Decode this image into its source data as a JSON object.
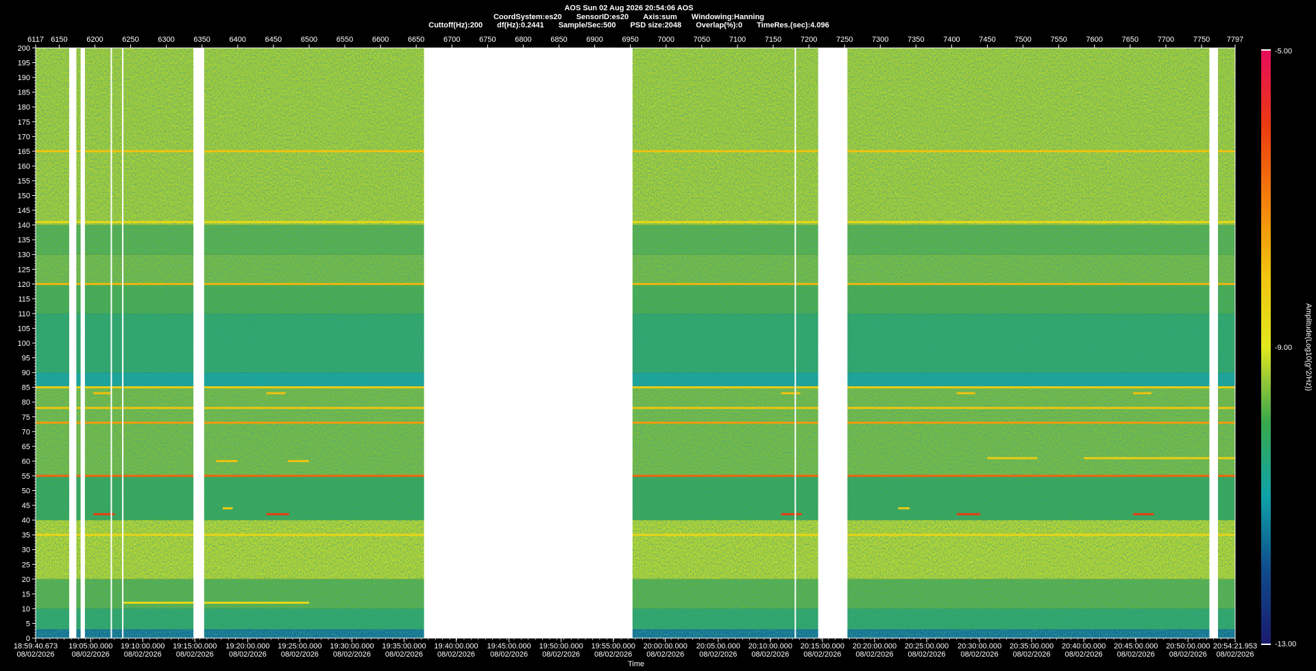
{
  "header": {
    "line1": "AOS  Sun 02 Aug 2026 20:54:06  AOS",
    "line2": [
      "CoordSystem:es20",
      "SensorID:es20",
      "Axis:sum",
      "Windowing:Hanning"
    ],
    "line3": [
      "Cuttoff(Hz):200",
      "df(Hz):0.2441",
      "Sample/Sec:500",
      "PSD size:2048",
      "Overlap(%):0",
      "TimeRes.(sec):4.096"
    ]
  },
  "chart_data": {
    "type": "heatmap",
    "title": "AOS  Sun 02 Aug 2026 20:54:06  AOS",
    "xlabel": "Time",
    "ylabel": "",
    "ylim": [
      0,
      200
    ],
    "y_ticks": [
      0,
      5,
      10,
      15,
      20,
      25,
      30,
      35,
      40,
      45,
      50,
      55,
      60,
      65,
      70,
      75,
      80,
      85,
      90,
      95,
      100,
      105,
      110,
      115,
      120,
      125,
      130,
      135,
      140,
      145,
      150,
      155,
      160,
      165,
      170,
      175,
      180,
      185,
      190,
      195,
      200
    ],
    "x_top_range": [
      6117,
      7797
    ],
    "x_top_ticks": [
      6117,
      6150,
      6200,
      6250,
      6300,
      6350,
      6400,
      6450,
      6500,
      6550,
      6600,
      6650,
      6700,
      6750,
      6800,
      6850,
      6900,
      6950,
      7000,
      7050,
      7100,
      7150,
      7200,
      7250,
      7300,
      7350,
      7400,
      7450,
      7500,
      7550,
      7600,
      7650,
      7700,
      7750,
      7797
    ],
    "x_bottom_ticks": [
      {
        "value": 6117,
        "time": "18:59:40.673",
        "date": "08/02/2026"
      },
      {
        "value": 6194,
        "time": "19:05:00.000",
        "date": "08/02/2026"
      },
      {
        "value": 6267,
        "time": "19:10:00.000",
        "date": "08/02/2026"
      },
      {
        "value": 6340,
        "time": "19:15:00.000",
        "date": "08/02/2026"
      },
      {
        "value": 6414,
        "time": "19:20:00.000",
        "date": "08/02/2026"
      },
      {
        "value": 6487,
        "time": "19:25:00.000",
        "date": "08/02/2026"
      },
      {
        "value": 6560,
        "time": "19:30:00.000",
        "date": "08/02/2026"
      },
      {
        "value": 6633,
        "time": "19:35:00.000",
        "date": "08/02/2026"
      },
      {
        "value": 6706,
        "time": "19:40:00.000",
        "date": "08/02/2026"
      },
      {
        "value": 6780,
        "time": "19:45:00.000",
        "date": "08/02/2026"
      },
      {
        "value": 6853,
        "time": "19:50:00.000",
        "date": "08/02/2026"
      },
      {
        "value": 6926,
        "time": "19:55:00.000",
        "date": "08/02/2026"
      },
      {
        "value": 6999,
        "time": "20:00:00.000",
        "date": "08/02/2026"
      },
      {
        "value": 7073,
        "time": "20:05:00.000",
        "date": "08/02/2026"
      },
      {
        "value": 7146,
        "time": "20:10:00.000",
        "date": "08/02/2026"
      },
      {
        "value": 7219,
        "time": "20:15:00.000",
        "date": "08/02/2026"
      },
      {
        "value": 7292,
        "time": "20:20:00.000",
        "date": "08/02/2026"
      },
      {
        "value": 7365,
        "time": "20:25:00.000",
        "date": "08/02/2026"
      },
      {
        "value": 7439,
        "time": "20:30:00.000",
        "date": "08/02/2026"
      },
      {
        "value": 7512,
        "time": "20:35:00.000",
        "date": "08/02/2026"
      },
      {
        "value": 7585,
        "time": "20:40:00.000",
        "date": "08/02/2026"
      },
      {
        "value": 7658,
        "time": "20:45:00.000",
        "date": "08/02/2026"
      },
      {
        "value": 7731,
        "time": "20:50:00.000",
        "date": "08/02/2026"
      },
      {
        "value": 7797,
        "time": "20:54:21.953",
        "date": "08/02/2026"
      }
    ],
    "data_gaps": [
      [
        6164,
        6174
      ],
      [
        6180,
        6186
      ],
      [
        6338,
        6353
      ],
      [
        6661,
        6953
      ],
      [
        7213,
        7254
      ],
      [
        7761,
        7773
      ]
    ],
    "gap_lines": [
      6223,
      6239,
      7181
    ],
    "background_bands": [
      {
        "y": [
          0,
          3
        ],
        "level": -11.6
      },
      {
        "y": [
          3,
          10
        ],
        "level": -10.3
      },
      {
        "y": [
          10,
          20
        ],
        "level": -9.8
      },
      {
        "y": [
          20,
          40
        ],
        "level": -9.2
      },
      {
        "y": [
          40,
          55
        ],
        "level": -10.1
      },
      {
        "y": [
          55,
          85
        ],
        "level": -9.6
      },
      {
        "y": [
          85,
          90
        ],
        "level": -10.9
      },
      {
        "y": [
          90,
          110
        ],
        "level": -10.3
      },
      {
        "y": [
          110,
          120
        ],
        "level": -9.9
      },
      {
        "y": [
          120,
          130
        ],
        "level": -9.6
      },
      {
        "y": [
          130,
          140
        ],
        "level": -9.8
      },
      {
        "y": [
          140,
          200
        ],
        "level": -9.3
      }
    ],
    "tone_lines": [
      {
        "y": 12,
        "level": -8.6,
        "x": [
          6240,
          6500
        ]
      },
      {
        "y": 35,
        "level": -8.5
      },
      {
        "y": 42,
        "level": -6.0,
        "x": [
          6198,
          6228
        ]
      },
      {
        "y": 42,
        "level": -6.0,
        "x": [
          6440,
          6472
        ]
      },
      {
        "y": 42,
        "level": -6.0,
        "x": [
          7161,
          7190
        ]
      },
      {
        "y": 42,
        "level": -6.0,
        "x": [
          7407,
          7440
        ]
      },
      {
        "y": 42,
        "level": -6.0,
        "x": [
          7654,
          7683
        ]
      },
      {
        "y": 44,
        "level": -8.2,
        "x": [
          6379,
          6393
        ]
      },
      {
        "y": 44,
        "level": -8.2,
        "x": [
          7325,
          7341
        ]
      },
      {
        "y": 55,
        "level": -6.6
      },
      {
        "y": 60,
        "level": -8.0,
        "x": [
          6370,
          6400
        ]
      },
      {
        "y": 60,
        "level": -8.0,
        "x": [
          6470,
          6500
        ]
      },
      {
        "y": 61,
        "level": -8.3,
        "x": [
          7450,
          7520
        ]
      },
      {
        "y": 61,
        "level": -8.3,
        "x": [
          7585,
          7797
        ]
      },
      {
        "y": 73,
        "level": -7.4
      },
      {
        "y": 78,
        "level": -8.1
      },
      {
        "y": 83,
        "level": -8.0,
        "x": [
          6198,
          6223
        ]
      },
      {
        "y": 83,
        "level": -8.0,
        "x": [
          6440,
          6467
        ]
      },
      {
        "y": 83,
        "level": -8.0,
        "x": [
          7161,
          7188
        ]
      },
      {
        "y": 83,
        "level": -8.0,
        "x": [
          7407,
          7433
        ]
      },
      {
        "y": 83,
        "level": -8.0,
        "x": [
          7654,
          7680
        ]
      },
      {
        "y": 85,
        "level": -8.2
      },
      {
        "y": 120,
        "level": -7.8
      },
      {
        "y": 141,
        "level": -8.6
      },
      {
        "y": 165,
        "level": -8.0
      }
    ],
    "colorbar": {
      "label": "Amplitude(Log10(g^2/Hz))",
      "range": [
        -13,
        -5
      ],
      "tick_labels": [
        {
          "value": -5,
          "text": "-5.00"
        },
        {
          "value": -9,
          "text": "-9.00"
        },
        {
          "value": -13,
          "text": "-13.00"
        }
      ],
      "stops": [
        {
          "value": -13,
          "color": "#1a1a6e"
        },
        {
          "value": -12,
          "color": "#0f4c8c"
        },
        {
          "value": -11,
          "color": "#0fa3a8"
        },
        {
          "value": -10,
          "color": "#3aa84a"
        },
        {
          "value": -9.5,
          "color": "#8ec43a"
        },
        {
          "value": -9,
          "color": "#e2e81e"
        },
        {
          "value": -8,
          "color": "#f1c20f"
        },
        {
          "value": -7,
          "color": "#f37f0c"
        },
        {
          "value": -6,
          "color": "#ec3a12"
        },
        {
          "value": -5,
          "color": "#e60c5a"
        }
      ]
    }
  }
}
